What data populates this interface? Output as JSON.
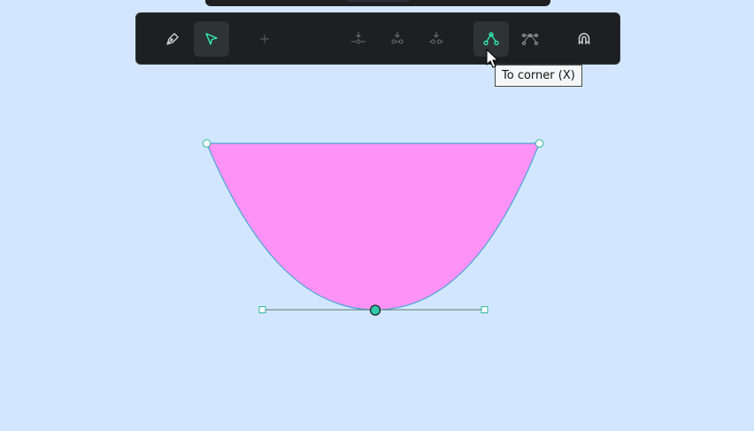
{
  "toolbar": {
    "tools": [
      {
        "name": "pen-tool",
        "icon": "pen-icon",
        "active": false
      },
      {
        "name": "select-tool",
        "icon": "select-arrow-icon",
        "active": true
      },
      {
        "name": "add-node",
        "icon": "plus-icon",
        "active": false
      },
      {
        "name": "merge-nodes",
        "icon": "merge-nodes-icon",
        "active": false
      },
      {
        "name": "join-nodes",
        "icon": "join-nodes-icon",
        "active": false
      },
      {
        "name": "separate-nodes",
        "icon": "separate-nodes-icon",
        "active": false
      },
      {
        "name": "to-corner",
        "icon": "to-corner-icon",
        "active": true
      },
      {
        "name": "to-curve",
        "icon": "to-curve-icon",
        "active": false
      },
      {
        "name": "snap-toggle",
        "icon": "magnet-icon",
        "active": false
      }
    ]
  },
  "tooltip": {
    "text": "To corner (X)"
  },
  "colors": {
    "canvas_bg": "#d2e7ff",
    "toolbar_bg": "#1d1f22",
    "accent": "#31efb8",
    "shape_fill": "#ff93f5",
    "shape_stroke": "#4aa6d8"
  }
}
